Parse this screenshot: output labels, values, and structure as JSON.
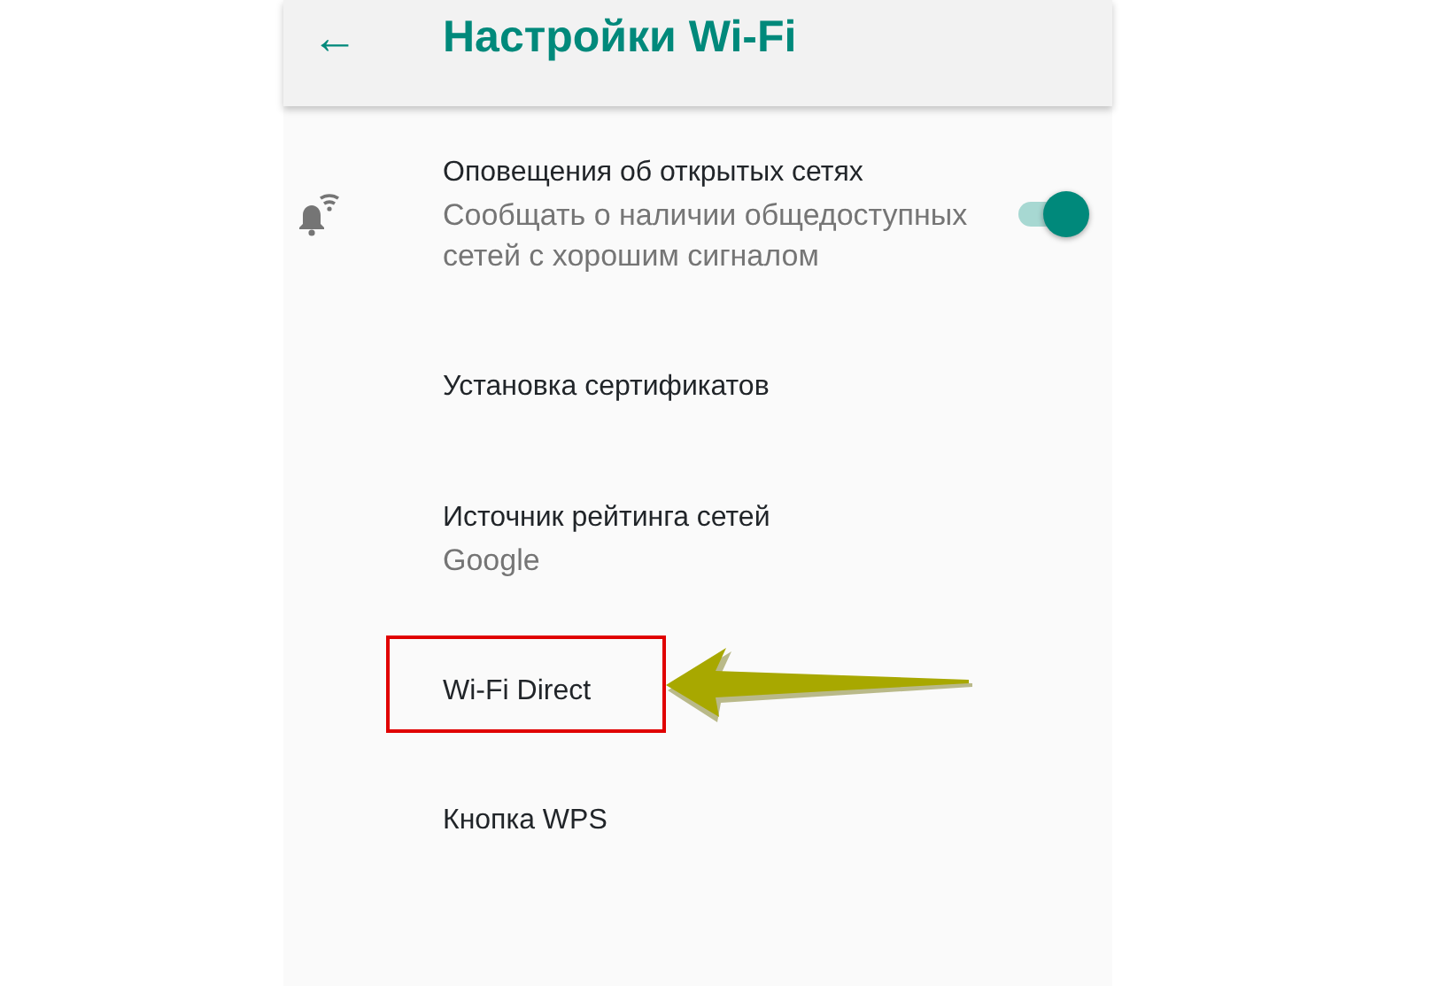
{
  "app_bar": {
    "back_icon": "←",
    "title": "Настройки Wi-Fi"
  },
  "settings": [
    {
      "kind": "toggle",
      "title": "Оповещения об открытых сетях",
      "summary": "Сообщать о наличии общедоступных сетей с хорошим сигналом",
      "on": true,
      "highlighted": false
    },
    {
      "kind": "plain",
      "title": "Установка сертификатов",
      "highlighted": false
    },
    {
      "kind": "plain",
      "title": "Источник рейтинга сетей",
      "summary": "Google",
      "highlighted": false
    },
    {
      "kind": "plain",
      "title": "Wi-Fi Direct",
      "highlighted": true
    },
    {
      "kind": "plain",
      "title": "Кнопка WPS",
      "highlighted": false
    }
  ]
}
